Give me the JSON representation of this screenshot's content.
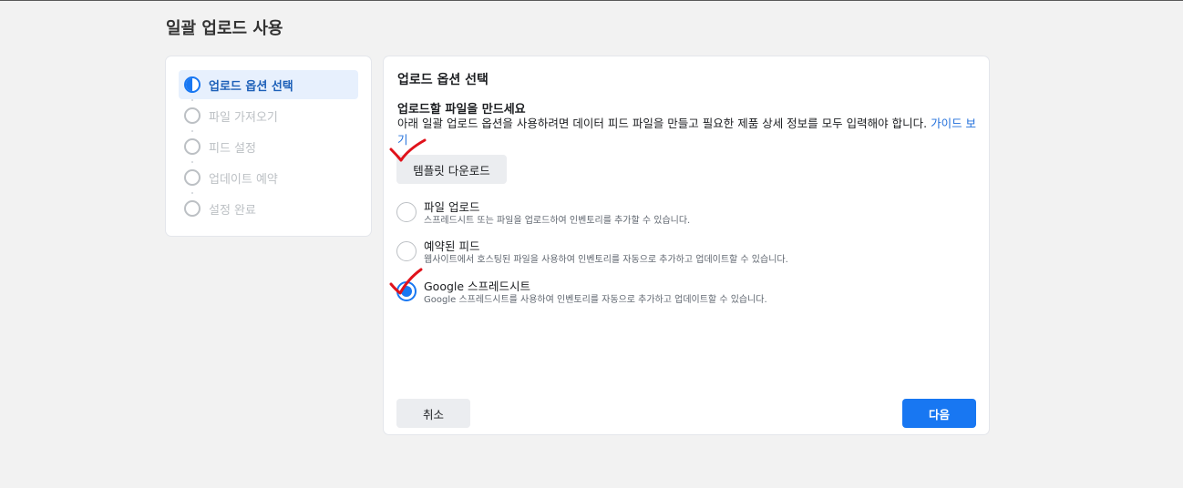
{
  "page": {
    "title": "일괄 업로드 사용"
  },
  "steps": [
    {
      "label": "업로드 옵션 선택",
      "state": "active"
    },
    {
      "label": "파일 가져오기",
      "state": "pending"
    },
    {
      "label": "피드 설정",
      "state": "pending"
    },
    {
      "label": "업데이트 예약",
      "state": "pending"
    },
    {
      "label": "설정 완료",
      "state": "pending"
    }
  ],
  "main": {
    "title": "업로드 옵션 선택",
    "heading": "업로드할 파일을 만드세요",
    "description": "아래 일괄 업로드 옵션을 사용하려면 데이터 피드 파일을 만들고 필요한 제품 상세 정보를 모두 입력해야 합니다. ",
    "guide_link": "가이드 보기",
    "template_button": "템플릿 다운로드",
    "options": [
      {
        "title": "파일 업로드",
        "desc": "스프레드시트 또는 파일을 업로드하여 인벤토리를 추가할 수 있습니다.",
        "checked": false
      },
      {
        "title": "예약된 피드",
        "desc": "웹사이트에서 호스팅된 파일을 사용하여 인벤토리를 자동으로 추가하고 업데이트할 수 있습니다.",
        "checked": false
      },
      {
        "title": "Google 스프레드시트",
        "desc": "Google 스프레드시트를 사용하여 인벤토리를 자동으로 추가하고 업데이트할 수 있습니다.",
        "checked": true
      }
    ],
    "cancel_button": "취소",
    "next_button": "다음"
  },
  "colors": {
    "accent": "#1877f2",
    "annotation": "#e0121b"
  }
}
